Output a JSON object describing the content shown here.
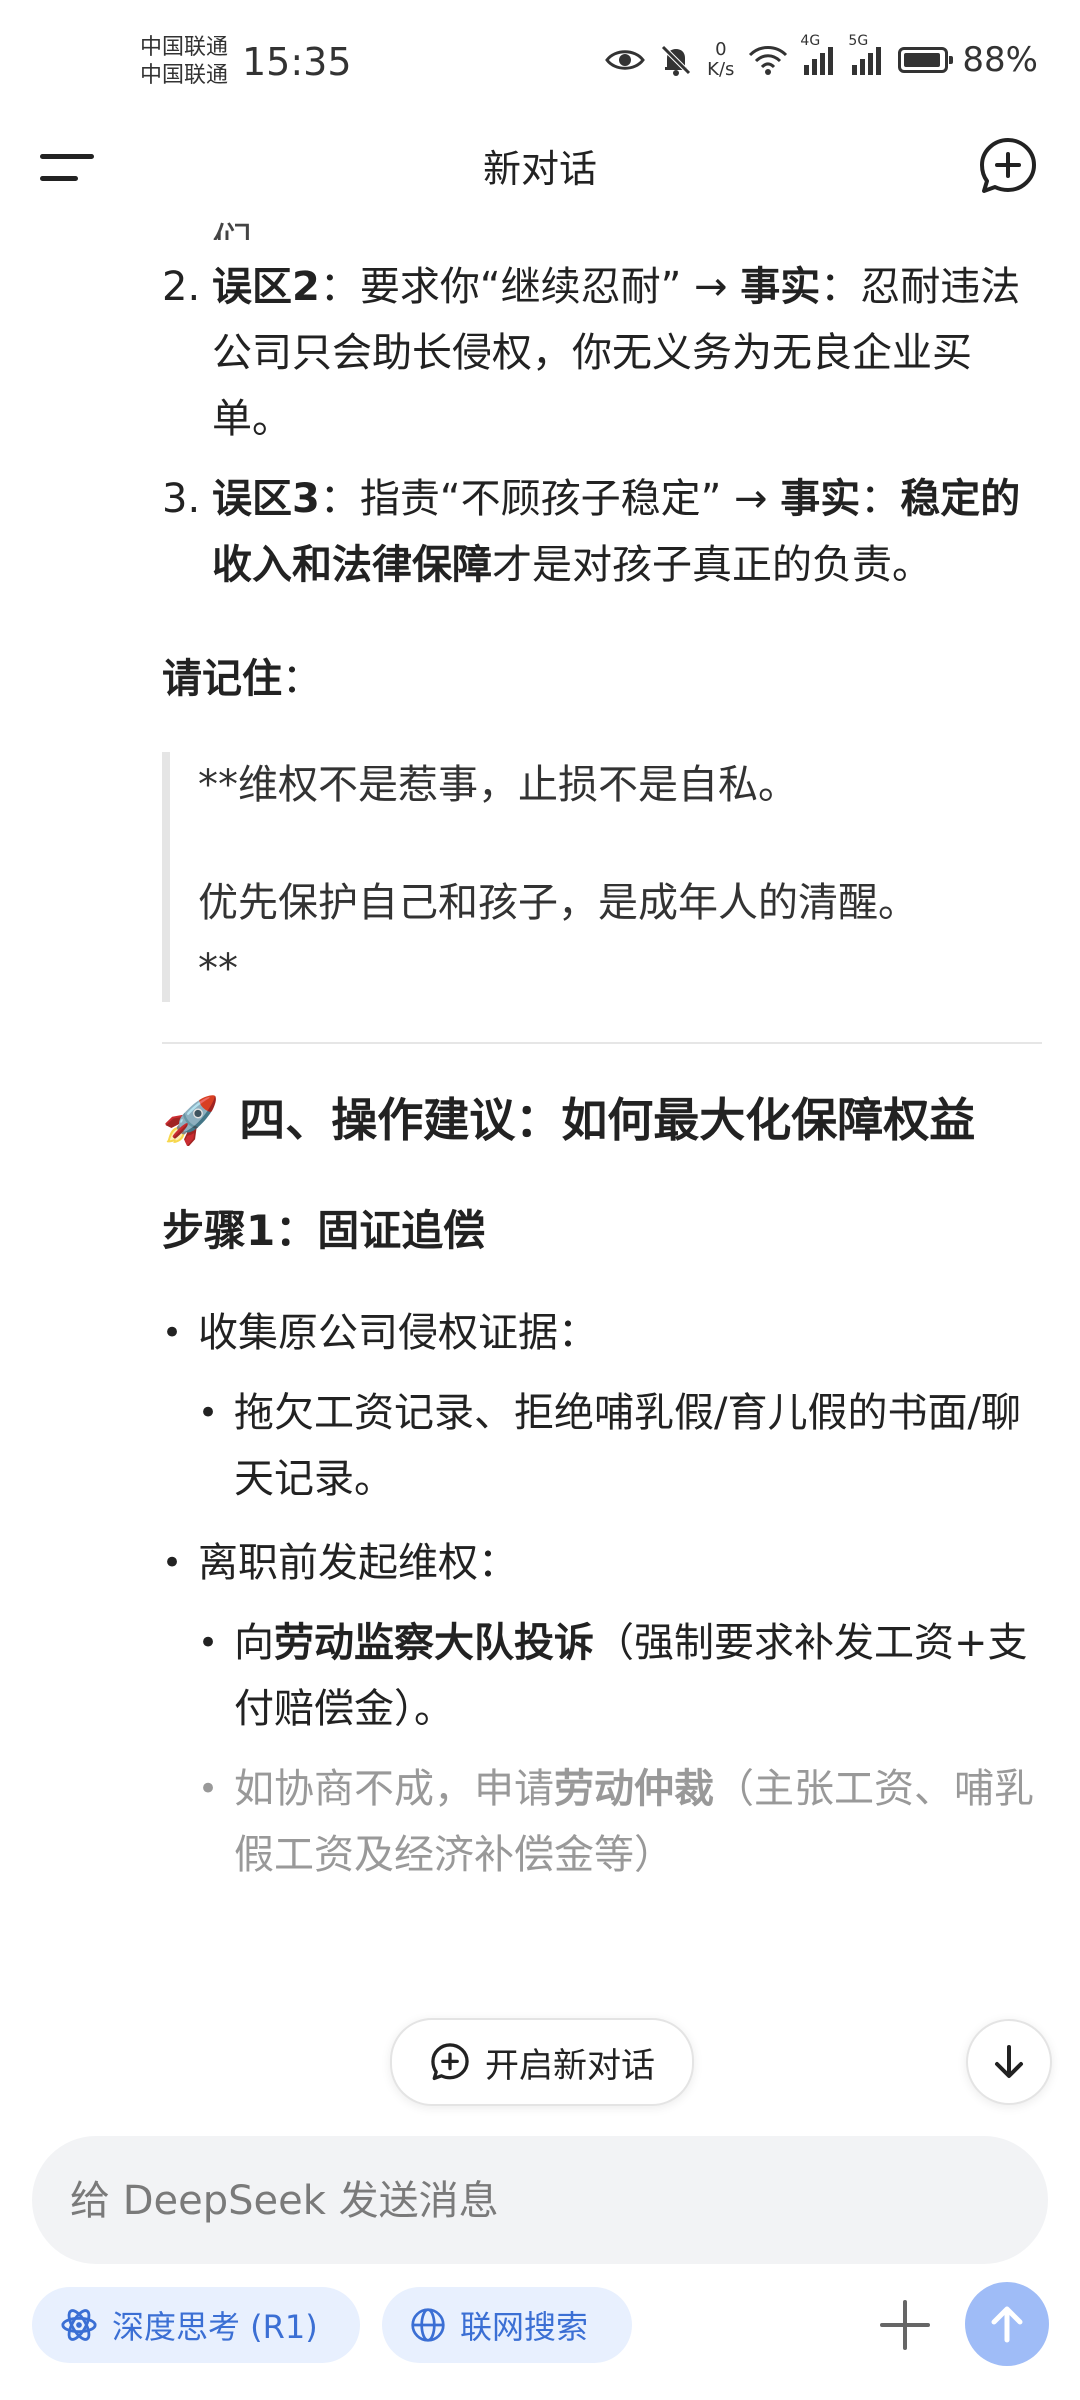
{
  "status_bar": {
    "carrier_1": "中国联通",
    "carrier_2": "中国联通",
    "time": "15:35",
    "net_speed_value": "0",
    "net_speed_unit": "K/s",
    "signal_1": "4G",
    "signal_2": "5G",
    "battery": "88%"
  },
  "header": {
    "title": "新对话"
  },
  "message": {
    "cutoff_fragment": "们。",
    "myths": [
      {
        "num": "2.",
        "label": "误区2",
        "sep": "：要求你“继续忍耐” → ",
        "fact_label": "事实",
        "fact": "：忍耐违法公司只会助长侵权，你无义务为无良企业买单。"
      },
      {
        "num": "3.",
        "label": "误区3",
        "sep": "：指责“不顾孩子稳定” → ",
        "fact_label": "事实",
        "fact_colon": "：",
        "fact_bold": "稳定的收入和法律保障",
        "fact_rest": "才是对孩子真正的负责。"
      }
    ],
    "remember_label": "请记住",
    "remember_colon": "：",
    "quote_line1": "**维权不是惹事，止损不是自私。",
    "quote_line2": "优先保护自己和孩子，是成年人的清醒。",
    "quote_line3": "**",
    "section_emoji": "🚀",
    "section_title": "四、操作建议：如何最大化保障权益",
    "step1": "步骤1：固证追偿",
    "bullet1": "收集原公司侵权证据：",
    "bullet1_sub1": "拖欠工资记录、拒绝哺乳假/育儿假的书面/聊天记录。",
    "bullet2": "离职前发起维权：",
    "bullet2_sub1_pre": "向",
    "bullet2_sub1_bold": "劳动监察大队投诉",
    "bullet2_sub1_rest": "（强制要求补发工资+支付赔偿金）。",
    "bullet2_sub2_pre": "如协商不成，申请",
    "bullet2_sub2_bold": "劳动仲裁",
    "bullet2_sub2_rest": "（主张工资、哺乳假工资及经济补偿金等）"
  },
  "floating": {
    "new_chat_label": "开启新对话"
  },
  "input": {
    "placeholder": "给 DeepSeek 发送消息",
    "value": ""
  },
  "toolbar": {
    "deep_think_label": "深度思考 (R1)",
    "web_search_label": "联网搜索"
  },
  "colors": {
    "accent": "#3b6fd4",
    "chip_bg": "#e8f0fe",
    "send_button": "#9fbcf7",
    "input_bg": "#f2f3f5"
  },
  "icons": {
    "menu": "menu-icon",
    "new_chat": "new-chat-icon",
    "scroll_down": "arrow-down-icon",
    "deep_think": "atom-icon",
    "web_search": "globe-icon",
    "attach": "plus-icon",
    "send": "arrow-up-icon"
  }
}
